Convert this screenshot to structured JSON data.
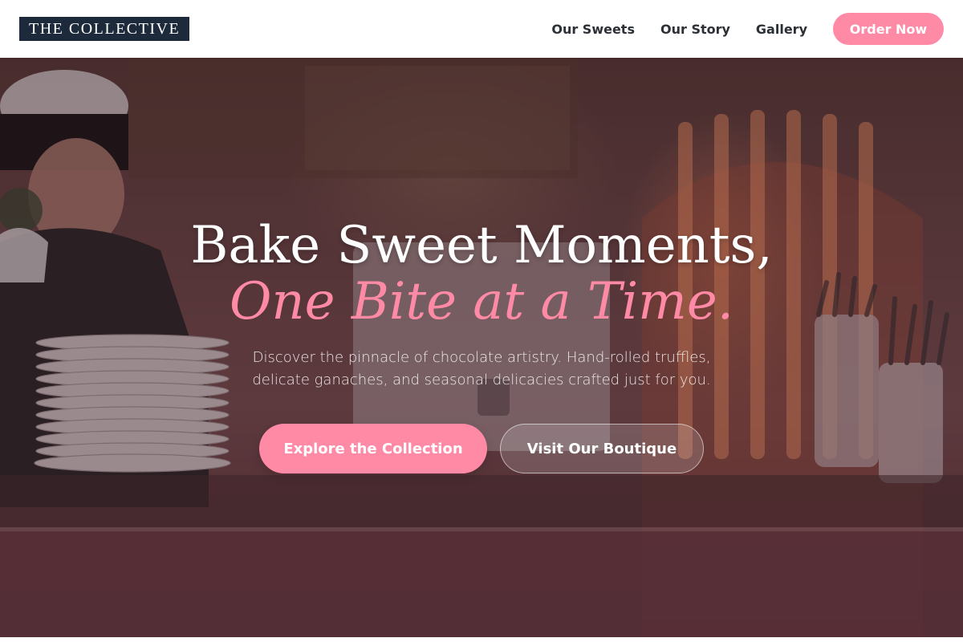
{
  "header": {
    "logo": "THE COLLECTIVE",
    "nav": [
      {
        "label": "Our Sweets"
      },
      {
        "label": "Our Story"
      },
      {
        "label": "Gallery"
      }
    ],
    "cta": "Order Now"
  },
  "hero": {
    "title": "Bake Sweet Moments,",
    "accent": "One Bite at a Time.",
    "description": "Discover the pinnacle of chocolate artistry. Hand-rolled truffles, delicate ganaches, and seasonal delicacies crafted just for you.",
    "primary_button": "Explore the Collection",
    "secondary_button": "Visit Our Boutique"
  },
  "colors": {
    "accent": "#ff8aa6",
    "logo_bg": "#1d2a3b",
    "nav_text": "#2b2f36"
  }
}
